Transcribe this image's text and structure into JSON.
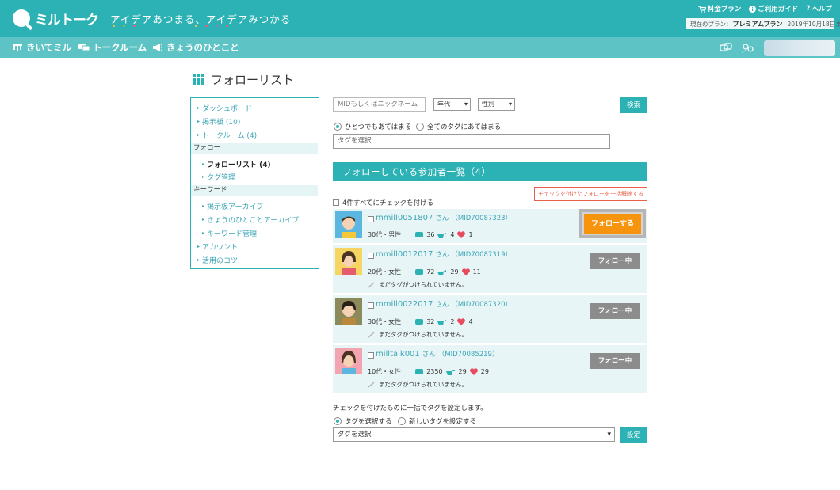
{
  "header": {
    "logo_text": "ミルトーク",
    "tagline": "アイデアあつまる、アイデアみつかる",
    "links": [
      {
        "label": "料金プラン",
        "icon": "cart-icon"
      },
      {
        "label": "ご利用ガイド",
        "icon": "info-icon"
      },
      {
        "label": "ヘルプ",
        "icon": "question-icon"
      }
    ],
    "plan_prefix": "現在のプラン：",
    "plan_name": "プレミアムプラン",
    "plan_expiry": "2019年10月18日まで"
  },
  "nav": {
    "items": [
      {
        "label": "きいてミル",
        "icon": "podium-icon"
      },
      {
        "label": "トークルーム",
        "icon": "chat-icon"
      },
      {
        "label": "きょうのひとこと",
        "icon": "megaphone-icon"
      }
    ]
  },
  "page": {
    "title": "フォローリスト"
  },
  "sidemenu": {
    "items": [
      "ダッシュボード",
      "掲示板 (10)",
      "トークルーム (4)"
    ],
    "follow_head": "フォロー",
    "follow_items": [
      "フォローリスト (4)",
      "タグ管理"
    ],
    "keyword_head": "キーワード",
    "keyword_items": [
      "掲示板アーカイブ",
      "きょうのひとことアーカイブ",
      "キーワード管理"
    ],
    "bottom_items": [
      "アカウント",
      "活用のコツ"
    ]
  },
  "search": {
    "placeholder": "MIDもしくはニックネーム",
    "age_select": "年代",
    "gender_select": "性別",
    "button": "検索",
    "radio_any": "ひとつでもあてはまる",
    "radio_all": "全てのタグにあてはまる",
    "tag_placeholder": "タグを選択"
  },
  "list": {
    "header": "フォローしている参加者一覧（4）",
    "bulk_unfollow": "チェックを付けたフォローを一括解除する",
    "check_all": "4件すべてにチェックを付ける",
    "san": "さん",
    "no_tag": "まだタグがつけられていません。",
    "users": [
      {
        "name": "mmill0051807",
        "mid": "（MID70087323）",
        "profile": "30代・男性",
        "posts": "36",
        "points": "4",
        "likes": "1",
        "button": "フォローする"
      },
      {
        "name": "mmill0012017",
        "mid": "（MID70087319）",
        "profile": "20代・女性",
        "posts": "72",
        "points": "29",
        "likes": "11",
        "button": "フォロー中"
      },
      {
        "name": "mmill0022017",
        "mid": "（MID70087320）",
        "profile": "30代・女性",
        "posts": "32",
        "points": "2",
        "likes": "4",
        "button": "フォロー中"
      },
      {
        "name": "milltalk001",
        "mid": "（MID70085219）",
        "profile": "10代・女性",
        "posts": "2350",
        "points": "29",
        "likes": "29",
        "button": "フォロー中"
      }
    ]
  },
  "bulk_tag": {
    "label": "チェックを付けたものに一括でタグを設定します。",
    "radio_select": "タグを選択する",
    "radio_new": "新しいタグを設定する",
    "select": "タグを選択",
    "button": "設定"
  },
  "colors": {
    "accent": "#2cb2b4",
    "nav": "#5ec3c5",
    "follow": "#f7940e",
    "following": "#8c8c8c"
  }
}
